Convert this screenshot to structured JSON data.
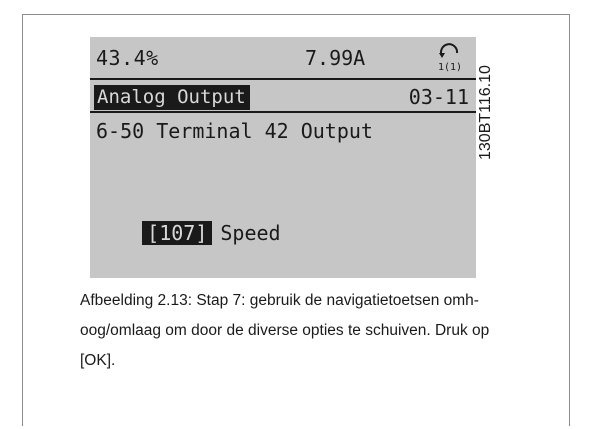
{
  "lcd": {
    "status": {
      "percent": "43.4%",
      "current": "7.99A",
      "setup_indicator": "1(1)"
    },
    "menu": {
      "title": "Analog Output",
      "code": "03-11"
    },
    "parameter": "6-50 Terminal 42 Output",
    "value": {
      "code": "[107]",
      "text": "Speed"
    }
  },
  "figure_id": "130BT116.10",
  "caption": {
    "lines": [
      "Afbeelding 2.13: Stap 7: gebruik de navigatietoetsen omh-",
      "oog/omlaag om door de diverse opties te schuiven. Druk op",
      "[OK]."
    ]
  },
  "colors": {
    "lcd_background": "#c6c6c6",
    "lcd_ink": "#1a1a1a",
    "frame_border": "#8c8c8c"
  }
}
